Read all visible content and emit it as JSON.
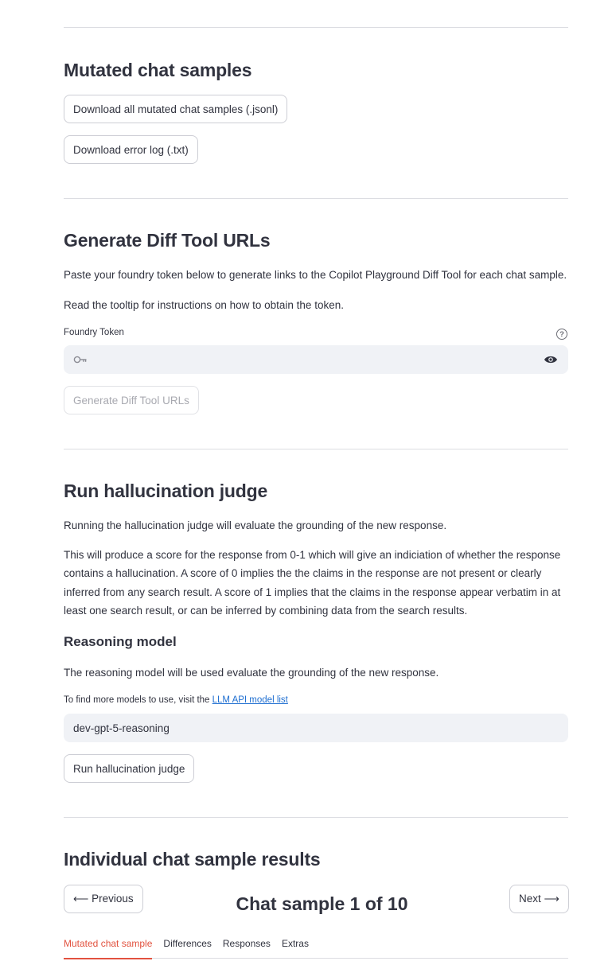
{
  "mutated": {
    "heading": "Mutated chat samples",
    "download_all_label": "Download all mutated chat samples (.jsonl)",
    "download_log_label": "Download error log (.txt)"
  },
  "diff_tool": {
    "heading": "Generate Diff Tool URLs",
    "paragraph1": "Paste your foundry token below to generate links to the Copilot Playground Diff Tool for each chat sample.",
    "paragraph2": "Read the tooltip for instructions on how to obtain the token.",
    "token_label": "Foundry Token",
    "token_value": "",
    "help_icon": "?",
    "generate_label": "Generate Diff Tool URLs"
  },
  "judge": {
    "heading": "Run hallucination judge",
    "paragraph1": "Running the hallucination judge will evaluate the grounding of the new response.",
    "paragraph2": "This will produce a score for the response from 0-1 which will give an indiciation of whether the response contains a hallucination. A score of 0 implies the the claims in the response are not present or clearly inferred from any search result. A score of 1 implies that the claims in the response appear verbatim in at least one search result, or can be inferred by combining data from the search results.",
    "model_heading": "Reasoning model",
    "model_paragraph": "The reasoning model will be used evaluate the grounding of the new response.",
    "model_hint_prefix": "To find more models to use, visit the ",
    "model_hint_link": "LLM API model list",
    "model_value": "dev-gpt-5-reasoning",
    "run_label": "Run hallucination judge"
  },
  "results": {
    "heading": "Individual chat sample results",
    "previous_label": "⟵ Previous",
    "next_label": "Next ⟶",
    "sample_title": "Chat sample 1 of 10",
    "tabs": [
      "Mutated chat sample",
      "Differences",
      "Responses",
      "Extras"
    ]
  },
  "colors": {
    "accent": "#e2523f",
    "link": "#1f6fd1",
    "text": "#31333f",
    "input_bg": "#f0f2f6"
  },
  "icons": {
    "key": "key-icon",
    "eye": "eye-icon",
    "help": "help-icon"
  }
}
